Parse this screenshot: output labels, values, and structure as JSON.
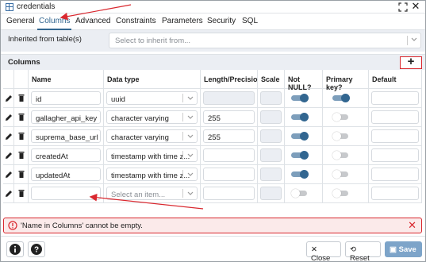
{
  "window": {
    "title": "credentials"
  },
  "tabs": [
    "General",
    "Columns",
    "Advanced",
    "Constraints",
    "Parameters",
    "Security",
    "SQL"
  ],
  "active_tab": "Columns",
  "inherit": {
    "label": "Inherited from table(s)",
    "placeholder": "Select to inherit from..."
  },
  "columns_section": {
    "label": "Columns",
    "add_label": "+"
  },
  "table": {
    "headers": [
      "Name",
      "Data type",
      "Length/Precision",
      "Scale",
      "Not NULL?",
      "Primary key?",
      "Default"
    ],
    "rows": [
      {
        "name": "id",
        "type": "uuid",
        "length": "",
        "not_null": true,
        "pk": true
      },
      {
        "name": "gallagher_api_key",
        "type": "character varying",
        "length": "255",
        "not_null": true,
        "pk": false
      },
      {
        "name": "suprema_base_url",
        "type": "character varying",
        "length": "255",
        "not_null": true,
        "pk": false
      },
      {
        "name": "createdAt",
        "type": "timestamp with time z...",
        "length": "",
        "not_null": true,
        "pk": false
      },
      {
        "name": "updatedAt",
        "type": "timestamp with time z...",
        "length": "",
        "not_null": true,
        "pk": false
      },
      {
        "name": "",
        "type": "",
        "type_placeholder": "Select an item...",
        "length": "",
        "not_null": false,
        "pk": false
      }
    ]
  },
  "error": {
    "message": "'Name in Columns' cannot be empty."
  },
  "footer": {
    "close": "Close",
    "reset": "Reset",
    "save": "Save"
  },
  "colors": {
    "accent": "#326690",
    "error": "#d9272e",
    "save_bg": "#7da4c9"
  }
}
